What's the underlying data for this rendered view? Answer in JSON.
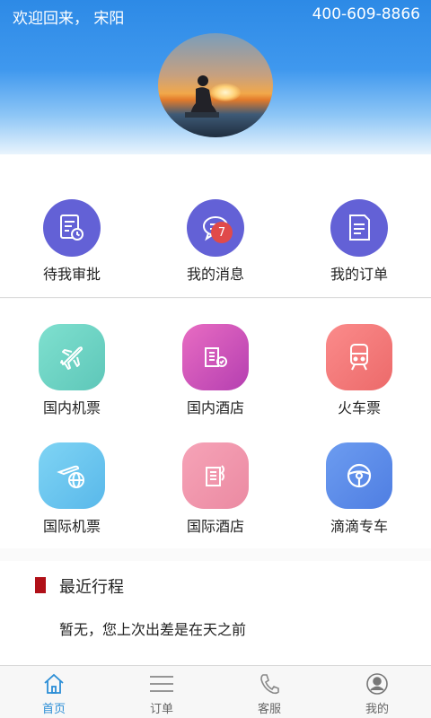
{
  "header": {
    "welcome": "欢迎回来， 宋阳",
    "phone": "400-609-8866"
  },
  "quick_actions": [
    {
      "label": "待我审批",
      "icon": "approval-icon"
    },
    {
      "label": "我的消息",
      "icon": "message-icon",
      "badge": "7"
    },
    {
      "label": "我的订单",
      "icon": "order-icon"
    }
  ],
  "services": [
    {
      "label": "国内机票",
      "icon": "airplane-icon"
    },
    {
      "label": "国内酒店",
      "icon": "hotel-icon"
    },
    {
      "label": "火车票",
      "icon": "train-icon"
    },
    {
      "label": "国际机票",
      "icon": "globe-airplane-icon"
    },
    {
      "label": "国际酒店",
      "icon": "hotel-building-icon"
    },
    {
      "label": "滴滴专车",
      "icon": "steering-wheel-icon"
    }
  ],
  "recent_trips": {
    "title": "最近行程",
    "message": "暂无，您上次出差是在天之前"
  },
  "tabbar": [
    {
      "label": "首页",
      "icon": "home-icon",
      "active": true
    },
    {
      "label": "订单",
      "icon": "list-icon"
    },
    {
      "label": "客服",
      "icon": "phone-icon"
    },
    {
      "label": "我的",
      "icon": "user-icon"
    }
  ],
  "colors": {
    "quick_action_purple": "#6361d6",
    "badge_red": "#e04a4a",
    "section_marker": "#b01018",
    "tab_active": "#2b8ed6"
  }
}
